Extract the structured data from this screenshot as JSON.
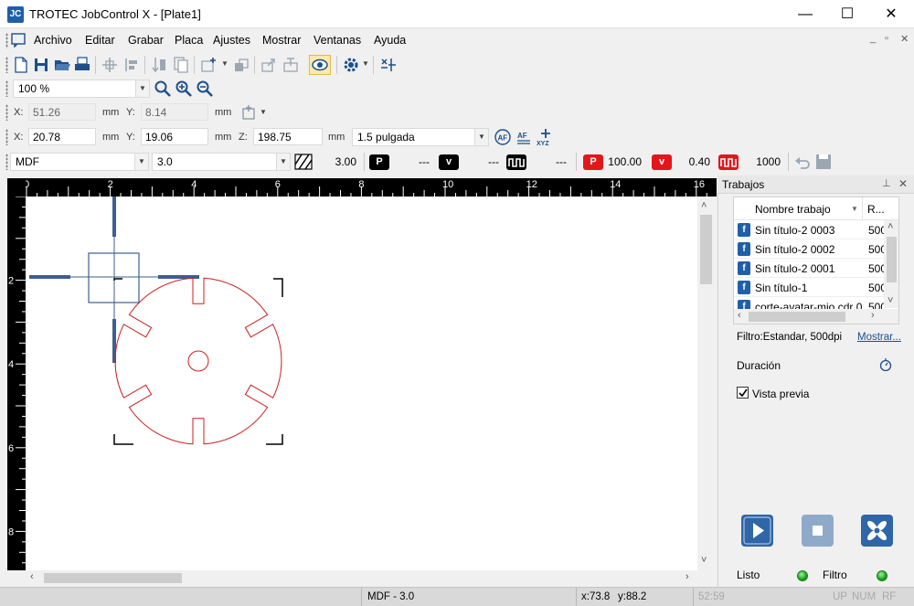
{
  "window": {
    "title": "TROTEC JobControl X - [Plate1]",
    "icon_text": "JC",
    "min_glyph": "—",
    "max_glyph": "☐",
    "close_glyph": "✕"
  },
  "menu": {
    "items": [
      "Archivo",
      "Editar",
      "Grabar",
      "Placa",
      "Ajustes",
      "Mostrar",
      "Ventanas",
      "Ayuda"
    ],
    "mdi_controls": [
      "_",
      "▫",
      "✕"
    ]
  },
  "zoom": {
    "value": "100 %"
  },
  "position_readout": {
    "x_label": "X:",
    "x_value": "51.26",
    "x_unit": "mm",
    "y_label": "Y:",
    "y_value": "8.14",
    "y_unit": "mm"
  },
  "laser_position": {
    "x_label": "X:",
    "x_value": "20.78",
    "x_unit": "mm",
    "y_label": "Y:",
    "y_value": "19.06",
    "y_unit": "mm",
    "z_label": "Z:",
    "z_value": "198.75",
    "z_unit": "mm",
    "lens": "1.5 pulgada"
  },
  "material": {
    "name": "MDF",
    "thickness": "3.0",
    "hatch_value": "3.00",
    "p_engrave_value": "---",
    "v_engrave_value": "---",
    "freq_engrave_value": "---",
    "p_cut_value": "100.00",
    "v_cut_value": "0.40",
    "freq_cut_value": "1000",
    "badge_p": "P",
    "badge_v": "v"
  },
  "ruler": {
    "top_labels": [
      "0",
      "2",
      "4",
      "6",
      "8",
      "10",
      "12",
      "14",
      "16"
    ],
    "left_labels": [
      "2",
      "4",
      "6",
      "8"
    ]
  },
  "panel": {
    "title": "Trabajos",
    "pin_glyph": "⊥",
    "close_glyph": "✕",
    "columns": [
      "Nombre trabajo",
      "R..."
    ],
    "jobs": [
      {
        "name": "Sin título-2 0003",
        "res": "500"
      },
      {
        "name": "Sin título-2 0002",
        "res": "500"
      },
      {
        "name": "Sin título-2 0001",
        "res": "500"
      },
      {
        "name": "Sin título-1",
        "res": "500"
      },
      {
        "name": "corte-avatar-mio.cdr 0",
        "res": "500"
      }
    ],
    "filter_text": "Filtro:Estandar, 500dpi",
    "show_link": "Mostrar...",
    "duration_label": "Duración",
    "preview_label": "Vista previa",
    "preview_checked": true,
    "status_ready": "Listo",
    "status_filter": "Filtro"
  },
  "status": {
    "material": "MDF - 3.0",
    "coords_x": "x:73.8",
    "coords_y": "y:88.2",
    "time": "52:59",
    "indicators": [
      "UP",
      "NUM",
      "RF"
    ]
  },
  "colors": {
    "accent": "#1f5fa8",
    "cut_red": "#cc1f1f",
    "led_green": "#17a317"
  }
}
